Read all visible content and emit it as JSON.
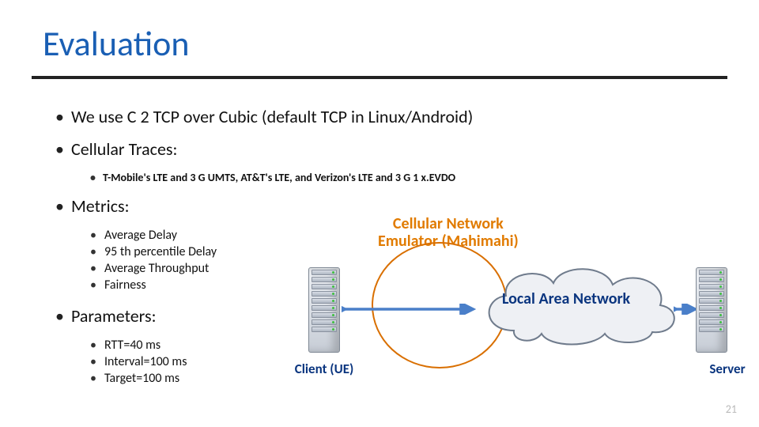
{
  "title": "Evaluation",
  "bullets": {
    "b1": "We use C 2 TCP over Cubic (default TCP in Linux/Android)",
    "b2": "Cellular Traces:",
    "b2_sub": "T-Mobile's LTE and 3 G UMTS, AT&T's LTE, and Verizon's LTE and 3 G 1 x.EVDO",
    "b3": "Metrics:",
    "b3_items": {
      "m1": "Average Delay",
      "m2": "95 th percentile Delay",
      "m3": "Average Throughput",
      "m4": "Fairness"
    },
    "b4": "Parameters:",
    "b4_items": {
      "p1": "RTT=40 ms",
      "p2": "Interval=100 ms",
      "p3": "Target=100 ms"
    }
  },
  "diagram": {
    "emulator_label_l1": "Cellular Network",
    "emulator_label_l2": "Emulator (Mahimahi)",
    "lan_label": "Local Area Network",
    "client_label": "Client (UE)",
    "server_label": "Server"
  },
  "page_number": "21"
}
